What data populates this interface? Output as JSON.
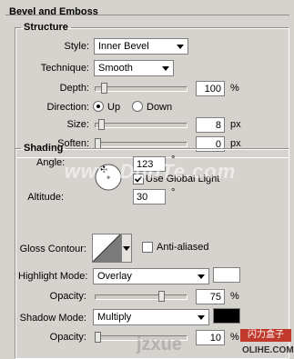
{
  "panel": {
    "title": "Bevel and Emboss"
  },
  "structure": {
    "title": "Structure",
    "style": {
      "label": "Style:",
      "value": "Inner Bevel"
    },
    "technique": {
      "label": "Technique:",
      "value": "Smooth"
    },
    "depth": {
      "label": "Depth:",
      "value": "100",
      "unit": "%",
      "level": 0.08
    },
    "direction": {
      "label": "Direction:",
      "up": "Up",
      "down": "Down",
      "selected": "Up"
    },
    "size": {
      "label": "Size:",
      "value": "8",
      "unit": "px",
      "level": 0.04
    },
    "soften": {
      "label": "Soften:",
      "value": "0",
      "unit": "px",
      "level": 0.0
    }
  },
  "shading": {
    "title": "Shading",
    "angle": {
      "label": "Angle:",
      "value": "123",
      "unit": "°"
    },
    "use_global_light": {
      "label": "Use Global Light",
      "checked": true
    },
    "altitude": {
      "label": "Altitude:",
      "value": "30",
      "unit": "°"
    },
    "gloss_contour": {
      "label": "Gloss Contour:",
      "anti_aliased": "Anti-aliased",
      "checked": false
    },
    "highlight_mode": {
      "label": "Highlight Mode:",
      "value": "Overlay",
      "color": "#ffffff"
    },
    "highlight_opacity": {
      "label": "Opacity:",
      "value": "75",
      "unit": "%",
      "level": 0.75
    },
    "shadow_mode": {
      "label": "Shadow Mode:",
      "value": "Multiply",
      "color": "#000000"
    },
    "shadow_opacity": {
      "label": "Opacity:",
      "value": "10",
      "unit": "%",
      "level": 0.0
    }
  },
  "watermarks": {
    "center": "www.DuoTe.com",
    "bottom_left": "jzxue",
    "bottom_right": "OLIHE.COM",
    "badge": "闪力盒子"
  }
}
